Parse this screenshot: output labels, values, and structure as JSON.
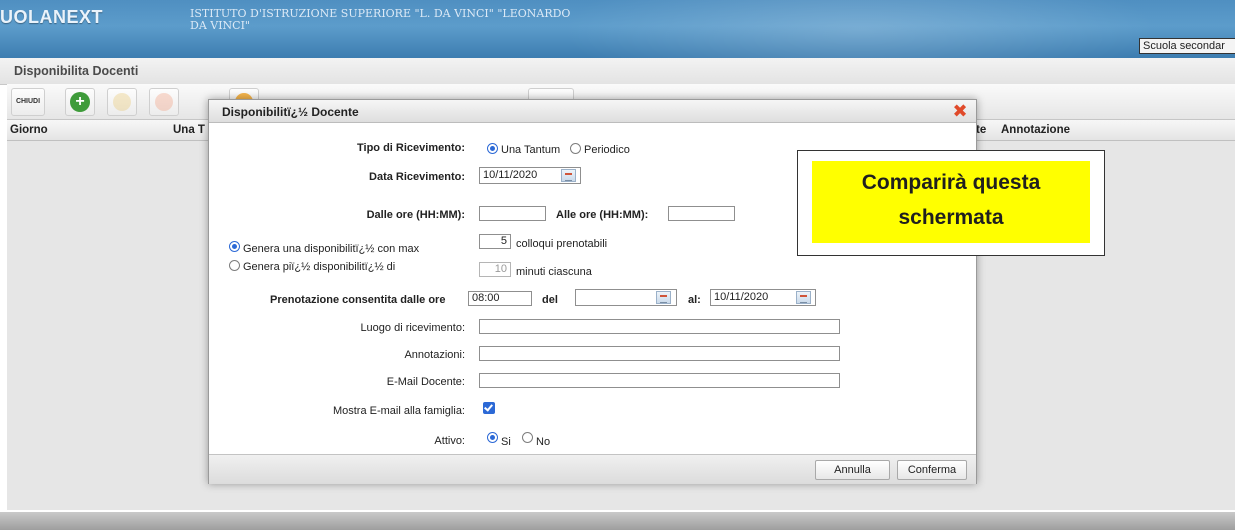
{
  "header": {
    "logo": "UOLANEXT",
    "school_name": "ISTITUTO D'ISTRUZIONE SUPERIORE \"L. DA VINCI\" \"LEONARDO DA VINCI\"",
    "school_select": "Scuola secondar"
  },
  "panel": {
    "title": "Disponibilita Docenti",
    "chiudi_label": "CHIUDI",
    "add_label": "+"
  },
  "grid": {
    "col_giorno": "Giorno",
    "col_una": "Una T",
    "col_te": "te",
    "col_annotazione": "Annotazione"
  },
  "modal": {
    "title": "Disponibilitï¿½ Docente",
    "close": "✖",
    "tipo_label": "Tipo di Ricevimento:",
    "tipo_options": [
      "Una Tantum",
      "Periodico"
    ],
    "data_label": "Data Ricevimento:",
    "data_value": "10/11/2020",
    "dalle_label": "Dalle ore (HH:MM):",
    "dalle_value": "",
    "alle_label": "Alle ore (HH:MM):",
    "alle_value": "",
    "genera_max_label": "Genera una disponibilitï¿½ con max",
    "genera_max_value": "5",
    "colloqui_label": "colloqui prenotabili",
    "genera_piu_label": "Genera piï¿½ disponibilitï¿½ di",
    "genera_piu_value": "10",
    "minuti_label": "minuti ciascuna",
    "prenotazione_label": "Prenotazione consentita dalle ore",
    "prenotazione_ore": "08:00",
    "del_label": "del",
    "del_value": "",
    "al_label": "al:",
    "al_value": "10/11/2020",
    "luogo_label": "Luogo di ricevimento:",
    "luogo_value": "",
    "annotazioni_label": "Annotazioni:",
    "annotazioni_value": "",
    "email_label": "E-Mail Docente:",
    "email_value": "",
    "mostra_label": "Mostra E-mail alla famiglia:",
    "attivo_label": "Attivo:",
    "attivo_options": [
      "Si",
      "No"
    ],
    "annulla": "Annulla",
    "conferma": "Conferma"
  },
  "callout": {
    "text": "Comparirà questa schermata"
  },
  "colors": {
    "header_blue": "#4f8fc1",
    "radio_blue": "#2c69d6",
    "close_red": "#e04a2a",
    "callout_yellow": "#ffff00"
  }
}
